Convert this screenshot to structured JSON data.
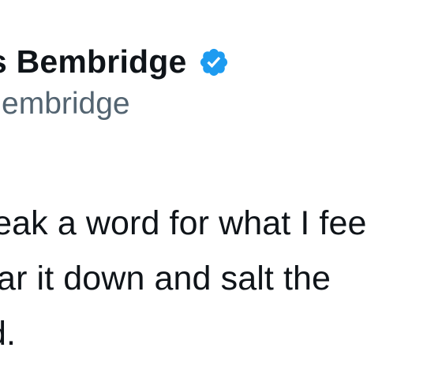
{
  "author": {
    "display_name": "s Bembridge",
    "handle": "Bembridge",
    "verified_icon": "verified-badge-icon",
    "verified_color": "#1d9bf0"
  },
  "tweet": {
    "lines": [
      "weak a word for what I fee",
      "tear it down and salt the",
      "od."
    ]
  },
  "colors": {
    "text_primary": "#0f1419",
    "text_secondary": "#536471",
    "background": "#ffffff"
  }
}
